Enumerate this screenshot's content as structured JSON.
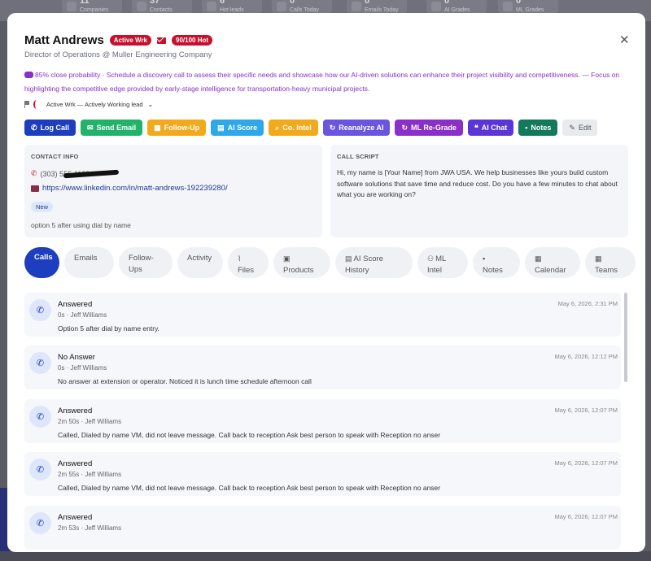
{
  "background": {
    "stats": [
      {
        "num": "11",
        "label": "Companies"
      },
      {
        "num": "37",
        "label": "Contacts"
      },
      {
        "num": "6",
        "label": "Hot leads"
      },
      {
        "num": "0",
        "label": "Calls Today"
      },
      {
        "num": "0",
        "label": "Emails Today"
      },
      {
        "num": "0",
        "label": "AI Grades"
      },
      {
        "num": "0",
        "label": "ML Grades"
      }
    ]
  },
  "contact": {
    "name": "Matt Andrews",
    "status_badge": "Active Wrk",
    "score_badge": "90/100 Hot",
    "title_company": "Director of Operations @ Muller Engineering Company"
  },
  "ai_note": {
    "text": "85% close probability · Schedule a discovery call to assess their specific needs and showcase how our AI-driven solutions can enhance their project visibility and competitiveness. — Focus on highlighting the competitive edge provided by early-stage intelligence for transportation-heavy municipal projects."
  },
  "status_select": {
    "value": "Active Wrk — Actively Working lead"
  },
  "actions": {
    "log_call": "Log Call",
    "send_email": "Send Email",
    "follow_up": "Follow-Up",
    "ai_score": "AI Score",
    "co_intel": "Co. Intel",
    "reanalyze": "Reanalyze AI",
    "ml_regrade": "ML Re-Grade",
    "ai_chat": "AI Chat",
    "notes": "Notes",
    "edit": "Edit"
  },
  "contact_info": {
    "heading": "CONTACT INFO",
    "phone": "(303) 555-1199",
    "linkedin": "https://www.linkedin.com/in/matt-andrews-192239280/",
    "tag": "New",
    "note": "option 5 after using dial by name"
  },
  "call_script": {
    "heading": "CALL SCRIPT",
    "text": "Hi, my name is [Your Name] from JWA USA. We help businesses like yours build custom software solutions that save time and reduce cost. Do you have a few minutes to chat about what you are working on?"
  },
  "tabs": [
    {
      "label": "Calls",
      "icon": ""
    },
    {
      "label": "Emails",
      "icon": ""
    },
    {
      "label": "Follow-\nUps",
      "icon": ""
    },
    {
      "label": "Activity",
      "icon": ""
    },
    {
      "label": "Files",
      "icon": "paperclip-icon"
    },
    {
      "label": "Products",
      "icon": "box-icon"
    },
    {
      "label": "AI Score\nHistory",
      "icon": "chart-icon"
    },
    {
      "label": "ML\nIntel",
      "icon": "brain-icon"
    },
    {
      "label": "Notes",
      "icon": "note-icon"
    },
    {
      "label": "Calendar",
      "icon": "calendar-icon"
    },
    {
      "label": "Teams",
      "icon": "grid-icon"
    }
  ],
  "calls": [
    {
      "outcome": "Answered",
      "meta": "0s · Jeff Williams",
      "note": "Option 5 after dial by name entry.",
      "date": "May 6, 2026, 2:31 PM"
    },
    {
      "outcome": "No Answer",
      "meta": "0s · Jeff Williams",
      "note": "No answer at extension or operator. Noticed it is lunch time schedule afternoon call",
      "date": "May 6, 2026, 12:12 PM"
    },
    {
      "outcome": "Answered",
      "meta": "2m 50s · Jeff Williams",
      "note": "Called, Dialed by name VM, did not leave message. Call back to reception Ask best person to speak with Reception no anser",
      "date": "May 6, 2026, 12:07 PM"
    },
    {
      "outcome": "Answered",
      "meta": "2m 55s · Jeff Williams",
      "note": "Called, Dialed by name VM, did not leave message. Call back to reception Ask best person to speak with Reception no anser",
      "date": "May 6, 2026, 12:07 PM"
    },
    {
      "outcome": "Answered",
      "meta": "2m 53s · Jeff Williams",
      "note": "",
      "date": "May 6, 2026, 12:07 PM"
    }
  ]
}
